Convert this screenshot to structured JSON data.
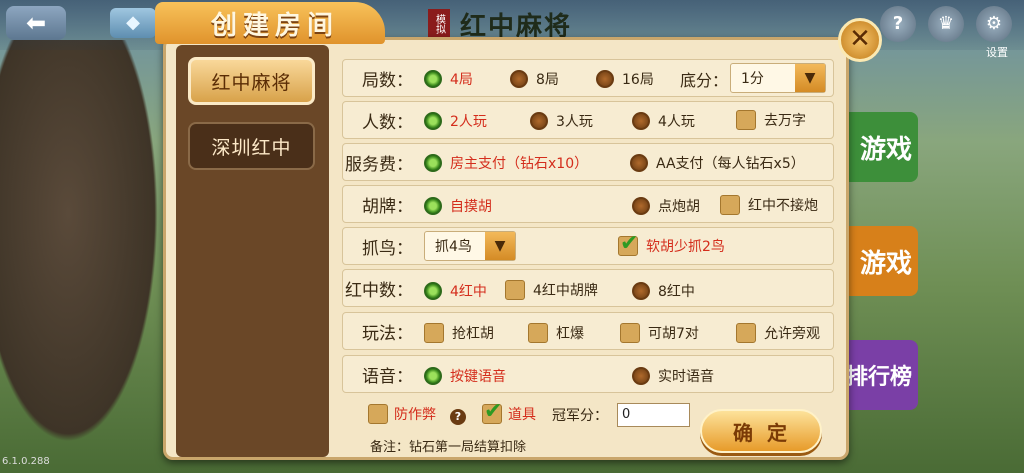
{
  "app": {
    "mode_tag": "模拟",
    "mode_name": "红中麻将",
    "version": "6.1.0.288",
    "settings_label": "设置",
    "top_icons": [
      "help-icon",
      "trophy-icon",
      "settings-icon"
    ],
    "side_buttons": [
      "游戏",
      "游戏",
      "排行榜"
    ]
  },
  "dialog": {
    "title": "创建房间",
    "close_label": "✕",
    "tabs": [
      {
        "label": "红中麻将",
        "active": true
      },
      {
        "label": "深圳红中",
        "active": false
      }
    ],
    "rows": {
      "rounds": {
        "label": "局数：",
        "options": [
          "4局",
          "8局",
          "16局"
        ],
        "selected": 0,
        "base_label": "底分：",
        "base_value": "1分"
      },
      "players": {
        "label": "人数：",
        "options": [
          "2人玩",
          "3人玩",
          "4人玩"
        ],
        "selected": 0,
        "check_label": "去万字"
      },
      "fee": {
        "label": "服务费：",
        "options": [
          "房主支付（钻石x10）",
          "AA支付（每人钻石x5）"
        ],
        "selected": 0
      },
      "hu": {
        "label": "胡牌：",
        "options": [
          "自摸胡",
          "点炮胡"
        ],
        "selected": 0,
        "check_label": "红中不接炮"
      },
      "bird": {
        "label": "抓鸟：",
        "select_value": "抓4鸟",
        "check_label": "软胡少抓2鸟",
        "check_on": true
      },
      "hongzhong": {
        "label": "红中数：",
        "opt1": "4红中",
        "check_label": "4红中胡牌",
        "opt2": "8红中"
      },
      "play": {
        "label": "玩法：",
        "checks": [
          "抢杠胡",
          "杠爆",
          "可胡7对",
          "允许旁观"
        ]
      },
      "voice": {
        "label": "语音：",
        "options": [
          "按键语音",
          "实时语音"
        ],
        "selected": 0
      }
    },
    "bottom": {
      "anti_cheat": "防作弊",
      "props": "道具",
      "champion_label": "冠军分：",
      "champion_value": "0",
      "note": "备注：钻石第一局结算扣除",
      "confirm": "确定"
    }
  },
  "colors": {
    "selected_text": "#d42d1c",
    "accent": "#e79b2a",
    "panel": "#6a4727"
  }
}
